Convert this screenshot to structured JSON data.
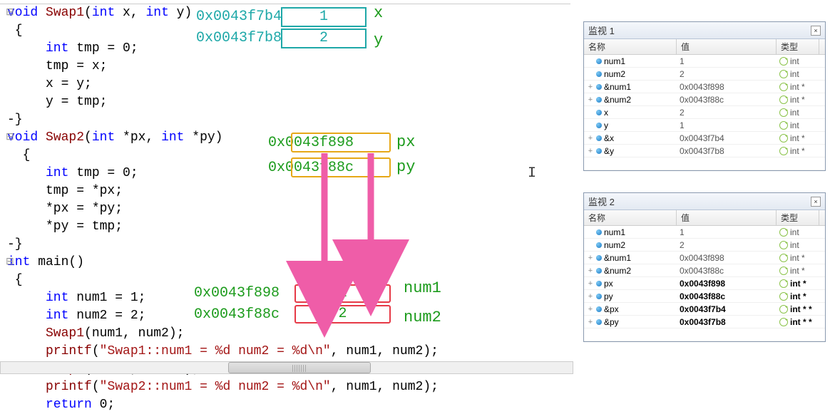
{
  "code": {
    "l1a": "void",
    "l1b": " Swap1",
    "l1c": "(",
    "l1d": "int",
    "l1e": " x, ",
    "l1f": "int",
    "l1g": " y)",
    "l2": " {",
    "l3a": "     int",
    "l3b": " tmp = 0;",
    "l4": "     tmp = x;",
    "l5": "     x = y;",
    "l6": "     y = tmp;",
    "l7": "-}",
    "l8a": "void",
    "l8b": " Swap2",
    "l8c": "(",
    "l8d": "int",
    "l8e": " *px, ",
    "l8f": "int",
    "l8g": " *py)",
    "l9": "  {",
    "l10a": "     int",
    "l10b": " tmp = 0;",
    "l11": "     tmp = *px;",
    "l12": "     *px = *py;",
    "l13": "     *py = tmp;",
    "l14": "-}",
    "l15a": "int",
    "l15b": " main()",
    "l16": " {",
    "l17a": "     int",
    "l17b": " num1 = 1;",
    "l18a": "     int",
    "l18b": " num2 = 2;",
    "l19a": "     Swap1",
    "l19b": "(num1, num2);",
    "l20a": "     printf",
    "l20b": "(",
    "l20c": "\"Swap1::num1 = %d num2 = %d\\n\"",
    "l20d": ", num1, num2);",
    "l21a": "     Swap2",
    "l21b": "(&num1, &num2);",
    "l22a": "     printf",
    "l22b": "(",
    "l22c": "\"Swap2::num1 = %d num2 = %d\\n\"",
    "l22d": ", num1, num2);",
    "l23a": "     return",
    "l23b": " 0;"
  },
  "annot": {
    "addr_x": "0x0043f7b4",
    "addr_y": "0x0043f7b8",
    "box_x": "1",
    "box_y": "2",
    "lbl_x": "x",
    "lbl_y": "y",
    "addr_px": "0x0043f898",
    "addr_py": "0x0043f88c",
    "lbl_px": "px",
    "lbl_py": "py",
    "addr_n1": "0x0043f898",
    "addr_n2": "0x0043f88c",
    "box_n1": "1",
    "box_n2": "2",
    "lbl_n1": "num1",
    "lbl_n2": "num2"
  },
  "watch1": {
    "title": "监视 1",
    "cols": {
      "name": "名称",
      "value": "值",
      "type": "类型"
    },
    "rows": [
      {
        "exp": "",
        "name": "num1",
        "value": "1",
        "type": "int",
        "bold": false
      },
      {
        "exp": "",
        "name": "num2",
        "value": "2",
        "type": "int",
        "bold": false
      },
      {
        "exp": "+",
        "name": "&num1",
        "value": "0x0043f898",
        "type": "int *",
        "bold": false
      },
      {
        "exp": "+",
        "name": "&num2",
        "value": "0x0043f88c",
        "type": "int *",
        "bold": false
      },
      {
        "exp": "",
        "name": "x",
        "value": "2",
        "type": "int",
        "bold": false
      },
      {
        "exp": "",
        "name": "y",
        "value": "1",
        "type": "int",
        "bold": false
      },
      {
        "exp": "+",
        "name": "&x",
        "value": "0x0043f7b4",
        "type": "int *",
        "bold": false
      },
      {
        "exp": "+",
        "name": "&y",
        "value": "0x0043f7b8",
        "type": "int *",
        "bold": false
      }
    ]
  },
  "watch2": {
    "title": "监视 2",
    "cols": {
      "name": "名称",
      "value": "值",
      "type": "类型"
    },
    "rows": [
      {
        "exp": "",
        "name": "num1",
        "value": "1",
        "type": "int",
        "bold": false
      },
      {
        "exp": "",
        "name": "num2",
        "value": "2",
        "type": "int",
        "bold": false
      },
      {
        "exp": "+",
        "name": "&num1",
        "value": "0x0043f898",
        "type": "int *",
        "bold": false
      },
      {
        "exp": "+",
        "name": "&num2",
        "value": "0x0043f88c",
        "type": "int *",
        "bold": false
      },
      {
        "exp": "+",
        "name": "px",
        "value": "0x0043f898",
        "type": "int *",
        "bold": true
      },
      {
        "exp": "+",
        "name": "py",
        "value": "0x0043f88c",
        "type": "int *",
        "bold": true
      },
      {
        "exp": "+",
        "name": "&px",
        "value": "0x0043f7b4",
        "type": "int * *",
        "bold": true
      },
      {
        "exp": "+",
        "name": "&py",
        "value": "0x0043f7b8",
        "type": "int * *",
        "bold": true
      }
    ]
  }
}
